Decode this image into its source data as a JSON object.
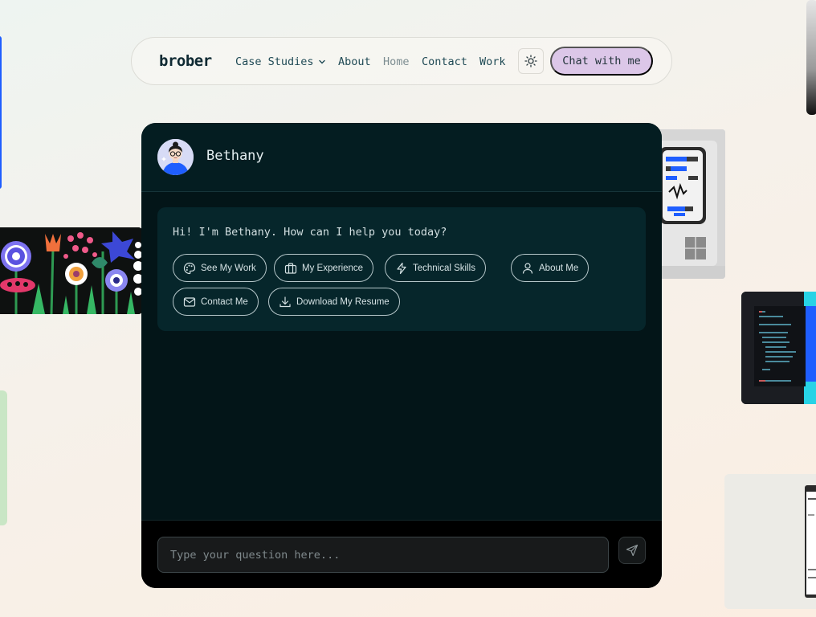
{
  "nav": {
    "logo": "brober",
    "links": [
      {
        "label": "Case Studies"
      },
      {
        "label": "About"
      },
      {
        "label": "Home"
      },
      {
        "label": "Contact"
      },
      {
        "label": "Work"
      }
    ],
    "theme_icon": "sun-icon",
    "chat_button": "Chat with me"
  },
  "chat": {
    "name": "Bethany",
    "avatar_icon": "avatar",
    "greeting": "Hi! I'm Bethany. How can I help you today?",
    "chips": [
      {
        "label": "See My Work",
        "icon": "palette-icon"
      },
      {
        "label": "My Experience",
        "icon": "briefcase-icon"
      },
      {
        "label": "Technical Skills",
        "icon": "lightning-icon"
      },
      {
        "label": "About Me",
        "icon": "user-icon"
      },
      {
        "label": "Contact Me",
        "icon": "mail-icon"
      },
      {
        "label": "Download My Resume",
        "icon": "download-icon"
      }
    ],
    "input_placeholder": "Type your question here...",
    "send_icon": "send-icon"
  },
  "colors": {
    "chat_button_bg": "#dcc7e8",
    "panel_bg": "#031518",
    "bubble_bg": "#06262b",
    "accent_blue": "#1f5eff"
  }
}
